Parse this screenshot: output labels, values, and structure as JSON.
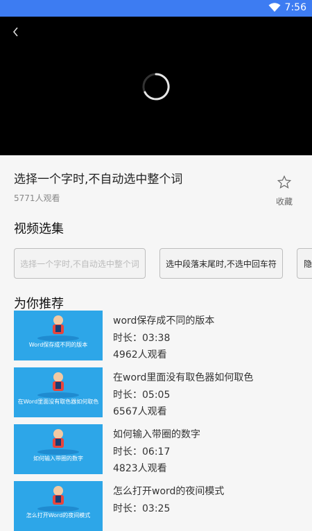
{
  "status": {
    "time": "7:56"
  },
  "video": {
    "title": "选择一个字时,不自动选中整个词",
    "views": "5771人观看"
  },
  "favorite": {
    "label": "收藏"
  },
  "sections": {
    "episodes": "视频选集",
    "recommend": "为你推荐"
  },
  "episodes": [
    {
      "label": "选择一个字时,不自动选中整个词"
    },
    {
      "label": "选中段落末尾时,不选中回车符"
    },
    {
      "label": "隐"
    }
  ],
  "recommendations": [
    {
      "title": "word保存成不同的版本",
      "duration": "时长：03:38",
      "views": "4962人观看",
      "caption": "Word保存成不同的版本"
    },
    {
      "title": "在word里面没有取色器如何取色",
      "duration": "时长：05:05",
      "views": "6567人观看",
      "caption": "在Word里面没有取色器如何取色"
    },
    {
      "title": "如何输入带圈的数字",
      "duration": "时长：06:17",
      "views": "4823人观看",
      "caption": "如何输入带圈的数字"
    },
    {
      "title": "怎么打开word的夜间模式",
      "duration": "时长：03:25",
      "views": "",
      "caption": "怎么打开Word的夜间模式"
    }
  ]
}
